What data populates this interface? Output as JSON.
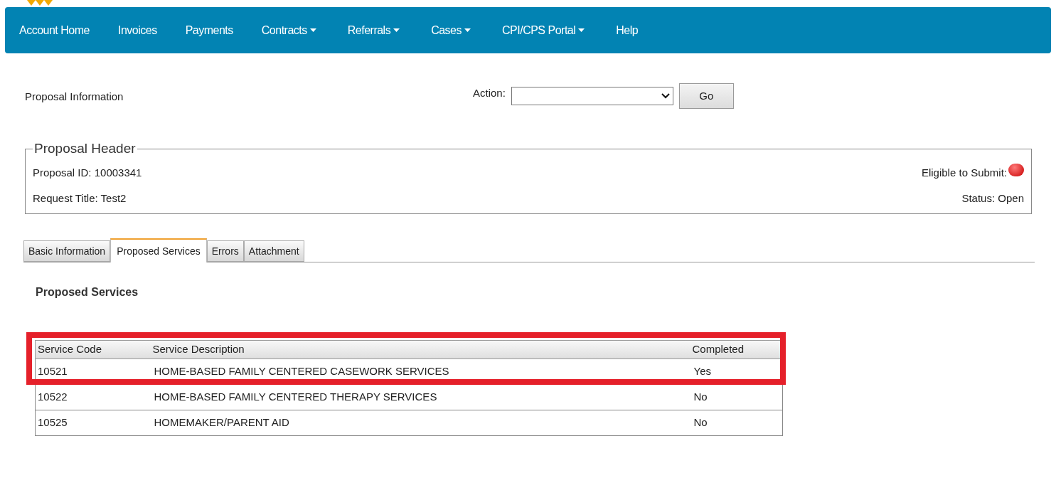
{
  "nav": [
    {
      "label": "Account Home",
      "dropdown": false
    },
    {
      "label": "Invoices",
      "dropdown": false
    },
    {
      "label": "Payments",
      "dropdown": false
    },
    {
      "label": "Contracts",
      "dropdown": true
    },
    {
      "label": "Referrals",
      "dropdown": true
    },
    {
      "label": "Cases",
      "dropdown": true
    },
    {
      "label": "CPI/CPS Portal",
      "dropdown": true
    },
    {
      "label": "Help",
      "dropdown": false
    }
  ],
  "page_title": "Proposal Information",
  "action": {
    "label": "Action:",
    "button": "Go"
  },
  "header": {
    "legend": "Proposal Header",
    "proposal_id": "Proposal ID: 10003341",
    "request_title": "Request Title: Test2",
    "eligible_label": "Eligible to Submit:",
    "eligible": false,
    "status": "Status: Open"
  },
  "tabs": [
    {
      "label": "Basic Information",
      "selected": false
    },
    {
      "label": "Proposed Services",
      "selected": true
    },
    {
      "label": "Errors",
      "selected": false
    },
    {
      "label": "Attachment",
      "selected": false
    }
  ],
  "section_title": "Proposed Services",
  "table": {
    "columns": [
      "Service Code",
      "Service Description",
      "Completed"
    ],
    "rows": [
      {
        "cells": [
          "10521",
          "HOME-BASED FAMILY CENTERED CASEWORK SERVICES",
          "Yes"
        ],
        "highlighted": true
      },
      {
        "cells": [
          "10522",
          "HOME-BASED FAMILY CENTERED THERAPY SERVICES",
          "No"
        ],
        "highlighted": false
      },
      {
        "cells": [
          "10525",
          "HOMEMAKER/PARENT AID",
          "No"
        ],
        "highlighted": false
      }
    ]
  }
}
